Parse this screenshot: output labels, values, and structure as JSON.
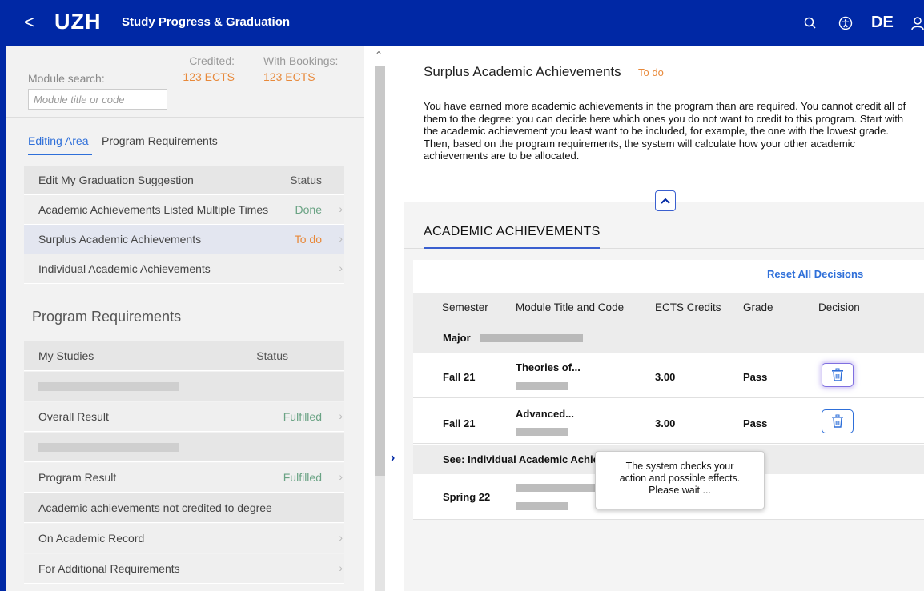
{
  "header": {
    "back_label": "<",
    "logo": "UZH",
    "title": "Study Progress & Graduation",
    "language": "DE",
    "icons": [
      "search-icon",
      "accessibility-icon",
      "user-icon"
    ]
  },
  "sidebar": {
    "search_label": "Module search:",
    "search_placeholder": "Module title or code",
    "credited_label": "Credited:",
    "credited_value": "123 ECTS",
    "bookings_label": "With Bookings:",
    "bookings_value": "123 ECTS",
    "tabs": [
      {
        "label": "Editing Area",
        "active": true
      },
      {
        "label": "Program Requirements",
        "active": false
      }
    ],
    "editing": {
      "header": {
        "label": "Edit My Graduation Suggestion",
        "status": "Status"
      },
      "items": [
        {
          "label": "Academic Achievements Listed Multiple Times",
          "status": "Done"
        },
        {
          "label": "Surplus Academic Achievements",
          "status": "To do"
        },
        {
          "label": "Individual Academic Achievements",
          "status": ""
        }
      ]
    },
    "program": {
      "title": "Program Requirements",
      "header": {
        "label": "My Studies",
        "status": "Status"
      },
      "overall": {
        "label": "Overall Result",
        "status": "Fulfilled"
      },
      "program_result": {
        "label": "Program Result",
        "status": "Fulfilled"
      },
      "not_credited": "Academic achievements not credited to degree",
      "on_record": "On Academic Record",
      "additional": "For Additional Requirements"
    }
  },
  "main": {
    "title": "Surplus Academic Achievements",
    "title_status": "To do",
    "description": "You have earned more academic achievements in the program than are required. You cannot credit all of them to the degree: you can decide here which ones you do not want to credit to this program. Start with the academic achievement you least want to be included, for example, the one with the lowest grade. Then, based on the program requirements, the system will calculate how your other academic achievements are to be allocated.",
    "section_title": "ACADEMIC ACHIEVEMENTS",
    "reset_label": "Reset All Decisions",
    "columns": [
      "Semester",
      "Module Title and Code",
      "ECTS Credits",
      "Grade",
      "Decision"
    ],
    "group_major": "Major",
    "rows": [
      {
        "semester": "Fall 21",
        "module": "Theories of...",
        "ects": "3.00",
        "grade": "Pass"
      },
      {
        "semester": "Fall 21",
        "module": "Advanced...",
        "ects": "3.00",
        "grade": "Pass"
      }
    ],
    "group_individual": "See: Individual Academic Achie",
    "individual_row": {
      "semester": "Spring 22"
    },
    "toast": {
      "line1": "The system checks your",
      "line2": "action and possible effects.",
      "line3": "Please wait ..."
    }
  },
  "colors": {
    "brand_blue": "#0028a5",
    "link_blue": "#2e6fd9",
    "todo_orange": "#e8893a",
    "done_green": "#6aa384"
  }
}
